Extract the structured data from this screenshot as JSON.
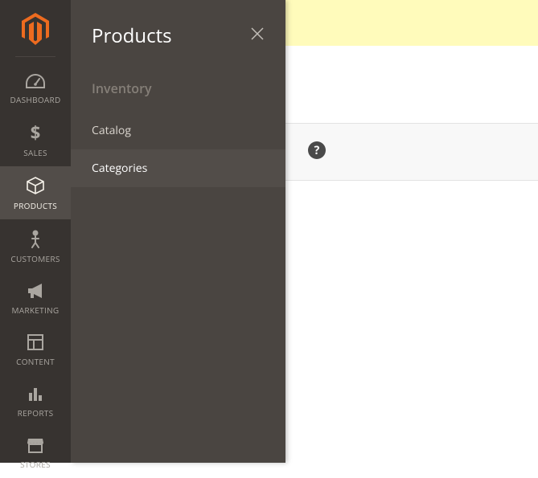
{
  "sidebar": {
    "items": [
      {
        "label": "DASHBOARD"
      },
      {
        "label": "SALES"
      },
      {
        "label": "PRODUCTS"
      },
      {
        "label": "CUSTOMERS"
      },
      {
        "label": "MARKETING"
      },
      {
        "label": "CONTENT"
      },
      {
        "label": "REPORTS"
      },
      {
        "label": "STORES"
      }
    ]
  },
  "flyout": {
    "title": "Products",
    "section_label": "Inventory",
    "items": [
      {
        "label": "Catalog"
      },
      {
        "label": "Categories"
      }
    ]
  },
  "help": {
    "glyph": "?"
  }
}
